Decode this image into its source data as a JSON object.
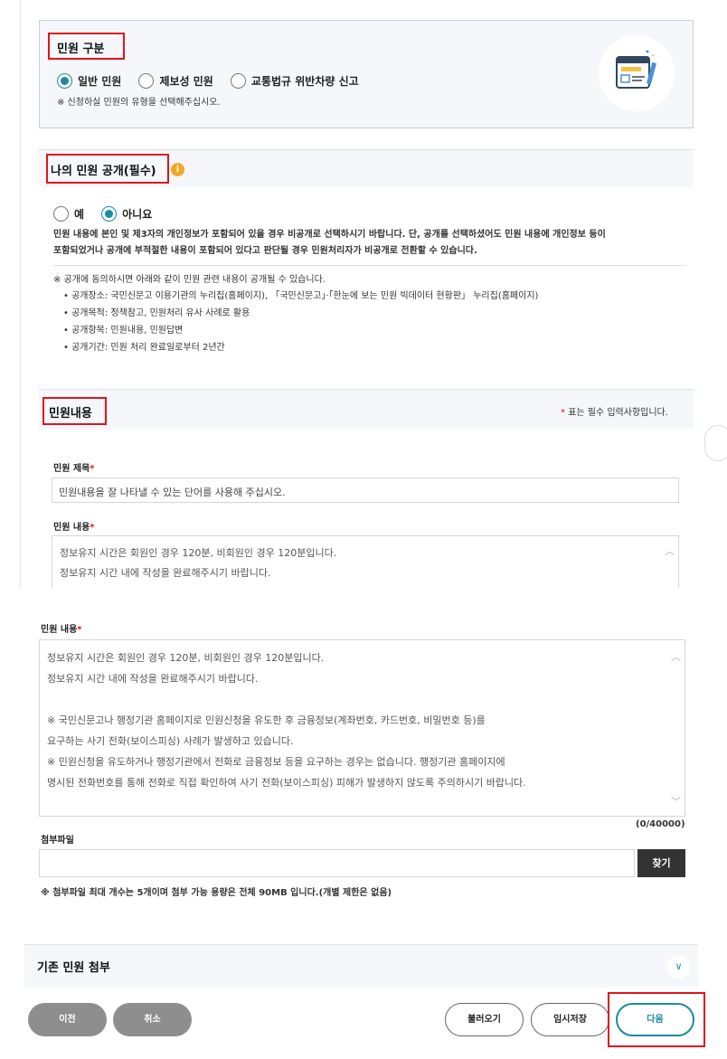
{
  "section1": {
    "title": "민원 구분",
    "options": [
      "일반 민원",
      "제보성 민원",
      "교통법규 위반차량 신고"
    ],
    "selected_index": 0,
    "note": "※ 신청하실 민원의 유형을 선택해주십시오."
  },
  "section2": {
    "title": "나의 민원 공개(필수)",
    "options": [
      "예",
      "아니요"
    ],
    "selected_index": 1,
    "desc_line1": "민원 내용에 본인 및 제3자의 개인정보가 포함되어 있을 경우 비공개로 선택하시기 바랍니다. 단, 공개를 선택하셨어도 민원 내용에 개인정보 등이",
    "desc_line2": "포함되었거나 공개에 부적절한 내용이 포함되어 있다고 판단될 경우 민원처리자가 비공개로 전환할 수 있습니다.",
    "notice": "※ 공개에 동의하시면 아래와 같이 민원 관련 내용이 공개될 수 있습니다.",
    "bullets": [
      "공개장소: 국민신문고 이용기관의 누리집(홈페이지), 「국민신문고」·「한눈에 보는 민원 빅데이터 현황판」 누리집(홈페이지)",
      "공개목적: 정책참고, 민원처리 유사 사례로 활용",
      "공개항목: 민원내용, 민원답변",
      "공개기간: 민원 처리 완료일로부터 2년간"
    ]
  },
  "section3": {
    "title": "민원내용",
    "required_note": "표는 필수 입력사항입니다.",
    "required_mark": "*",
    "subject_label": "민원 제목",
    "subject_placeholder": "민원내용을 잘 나타낼 수 있는 단어를 사용해 주십시오.",
    "content_label": "민원 내용",
    "content_lines_short": [
      "정보유지 시간은 회원인 경우 120분, 비회원인 경우 120분입니다.",
      "정보유지 시간 내에 작성을 완료해주시기 바랍니다."
    ]
  },
  "section4": {
    "content_label": "민원 내용",
    "content_lines": [
      "정보유지 시간은 회원인 경우 120분, 비회원인 경우 120분입니다.",
      "정보유지 시간 내에 작성을 완료해주시기 바랍니다.",
      "",
      "※ 국민신문고나 행정기관 홈페이지로 민원신청을 유도한 후 금융정보(계좌번호, 카드번호, 비밀번호 등)를",
      "요구하는 사기 전화(보이스피싱) 사례가 발생하고 있습니다.",
      "※ 민원신청을 유도하거나 행정기관에서 전화로 금융정보 등을 요구하는 경우는 없습니다. 행정기관 홈페이지에",
      "명시된 전화번호를 통해 전화로 직접 확인하여 사기 전화(보이스피싱) 피해가 발생하지 않도록 주의하시기 바랍니다."
    ],
    "counter": "(0/40000)",
    "attach_label": "첨부파일",
    "find_button": "찾기",
    "attach_note": "※ 첨부파일 최대 개수는 5개이며 첨부 가능 용량은 전체 90MB 입니다.(개별 제한은 없음)",
    "existing_title": "기존 민원 첨부"
  },
  "footer": {
    "prev": "이전",
    "cancel": "취소",
    "load": "불러오기",
    "temp_save": "임시저장",
    "next": "다음"
  },
  "colors": {
    "accent": "#1a8aa3",
    "highlight": "#e0141e",
    "dark_button": "#333333",
    "gray_button": "#8e8e8e",
    "info_icon": "#f5a623"
  }
}
